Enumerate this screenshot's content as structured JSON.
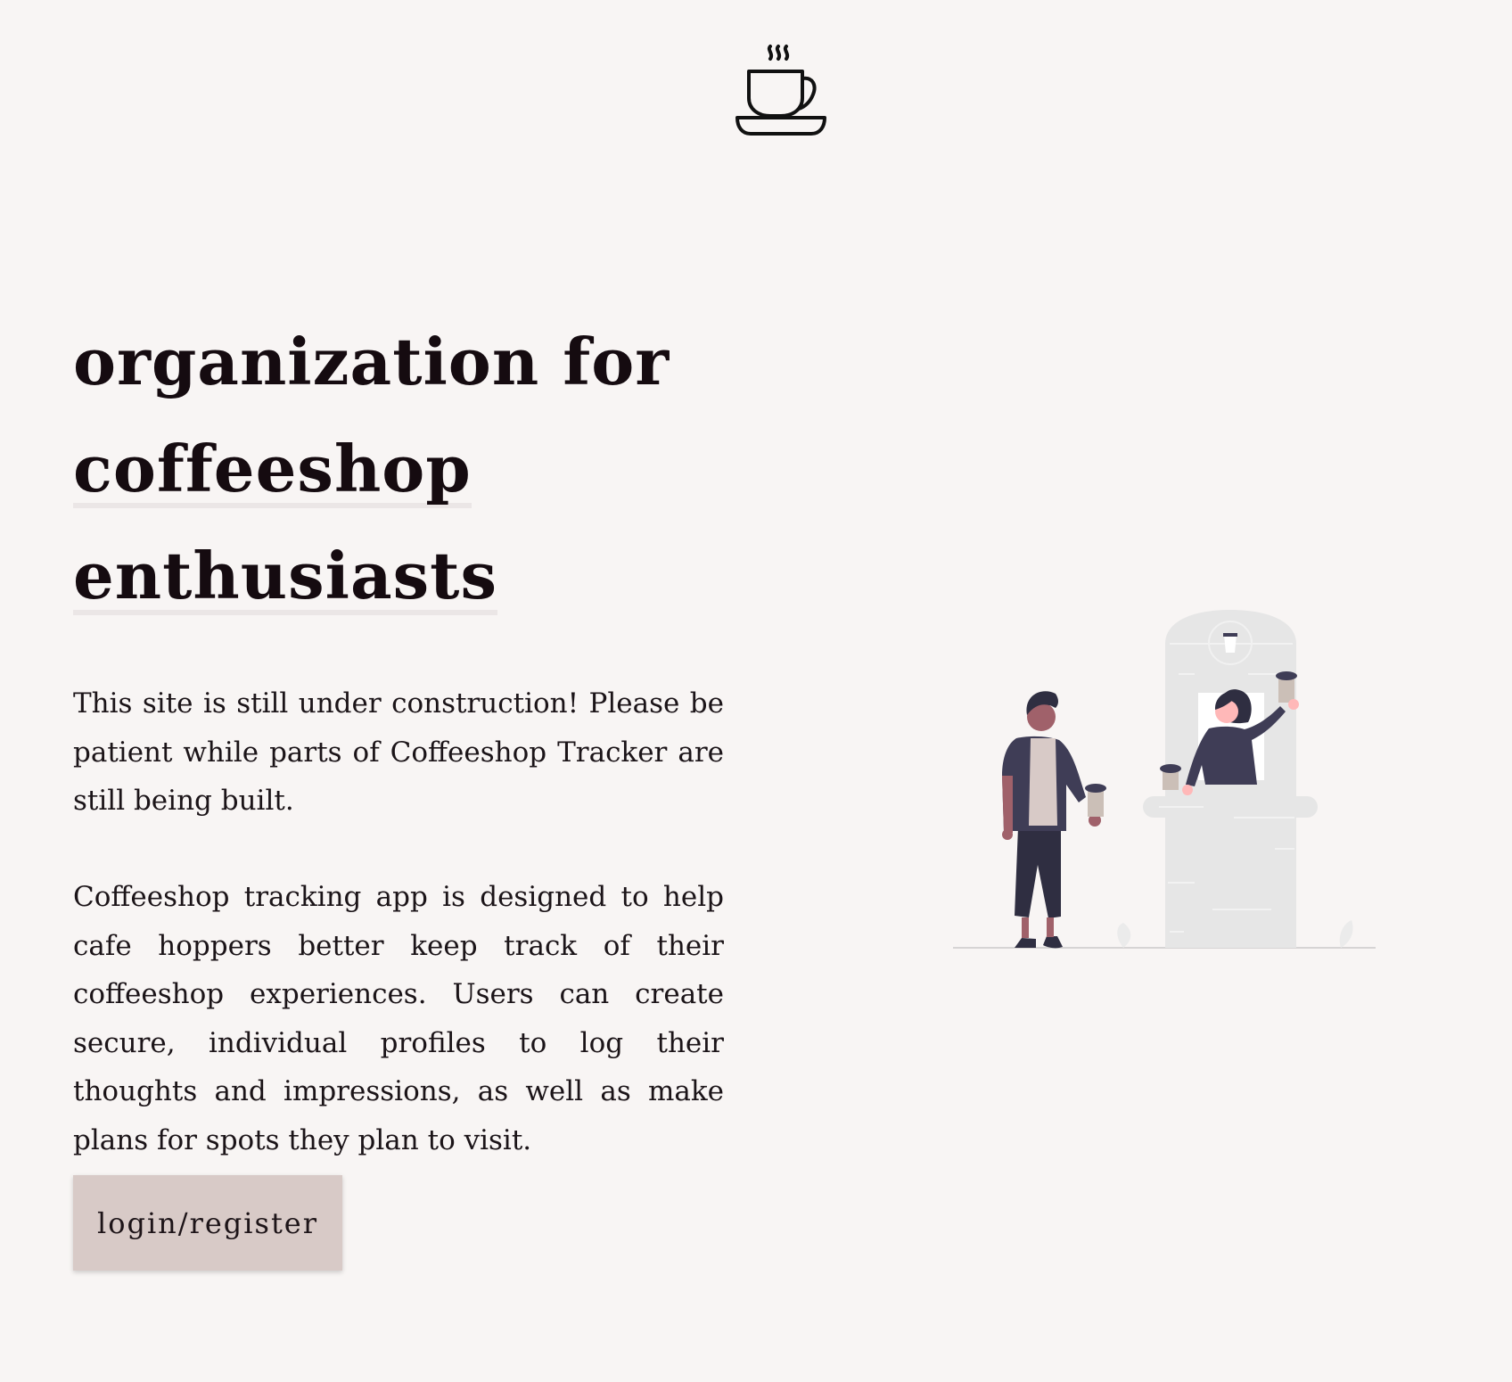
{
  "header": {
    "logo_icon": "coffee-cup-icon"
  },
  "hero": {
    "title_line1": "organization for",
    "title_line2": "coffeeshop",
    "title_line3": "enthusiasts"
  },
  "intro": {
    "paragraph1": "This site is still under construction! Please be patient while parts of Coffeeshop Tracker are still being built.",
    "paragraph2": "Coffeeshop tracking app is designed to help cafe hoppers better keep track of their coffeeshop experiences. Users can create secure, individual profiles to log their thoughts and impressions, as well as make plans for spots they plan to visit."
  },
  "actions": {
    "login_label": "login/register"
  },
  "illustration": {
    "icon": "coffee-shop-illustration"
  },
  "colors": {
    "background": "#f8f5f4",
    "title": "#150b10",
    "button": "#d8cac7",
    "title_underline": "#ebe6e6"
  }
}
